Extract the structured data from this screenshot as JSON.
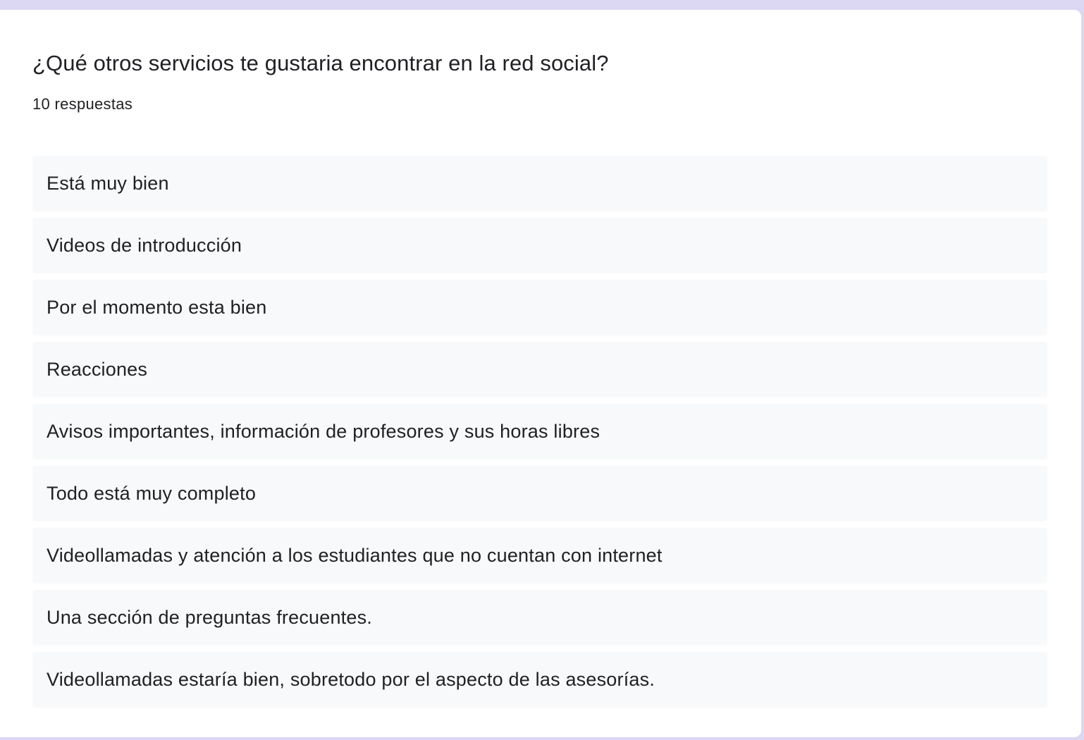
{
  "question": {
    "title": "¿Qué otros servicios te gustaria encontrar en la red social?",
    "response_count": "10 respuestas"
  },
  "responses": [
    "Está muy bien",
    "Videos de introducción",
    "Por el momento esta bien",
    "Reacciones",
    "Avisos importantes, información de profesores y sus horas libres",
    "Todo está muy completo",
    "Videollamadas y atención a los estudiantes que no cuentan con internet",
    "Una sección de preguntas frecuentes.",
    "Videollamadas estaría bien, sobretodo por el aspecto de las asesorías."
  ],
  "colors": {
    "page_background": "#dcd8f3",
    "card_background": "#ffffff",
    "response_background": "#f8f9fa",
    "text": "#202124"
  }
}
